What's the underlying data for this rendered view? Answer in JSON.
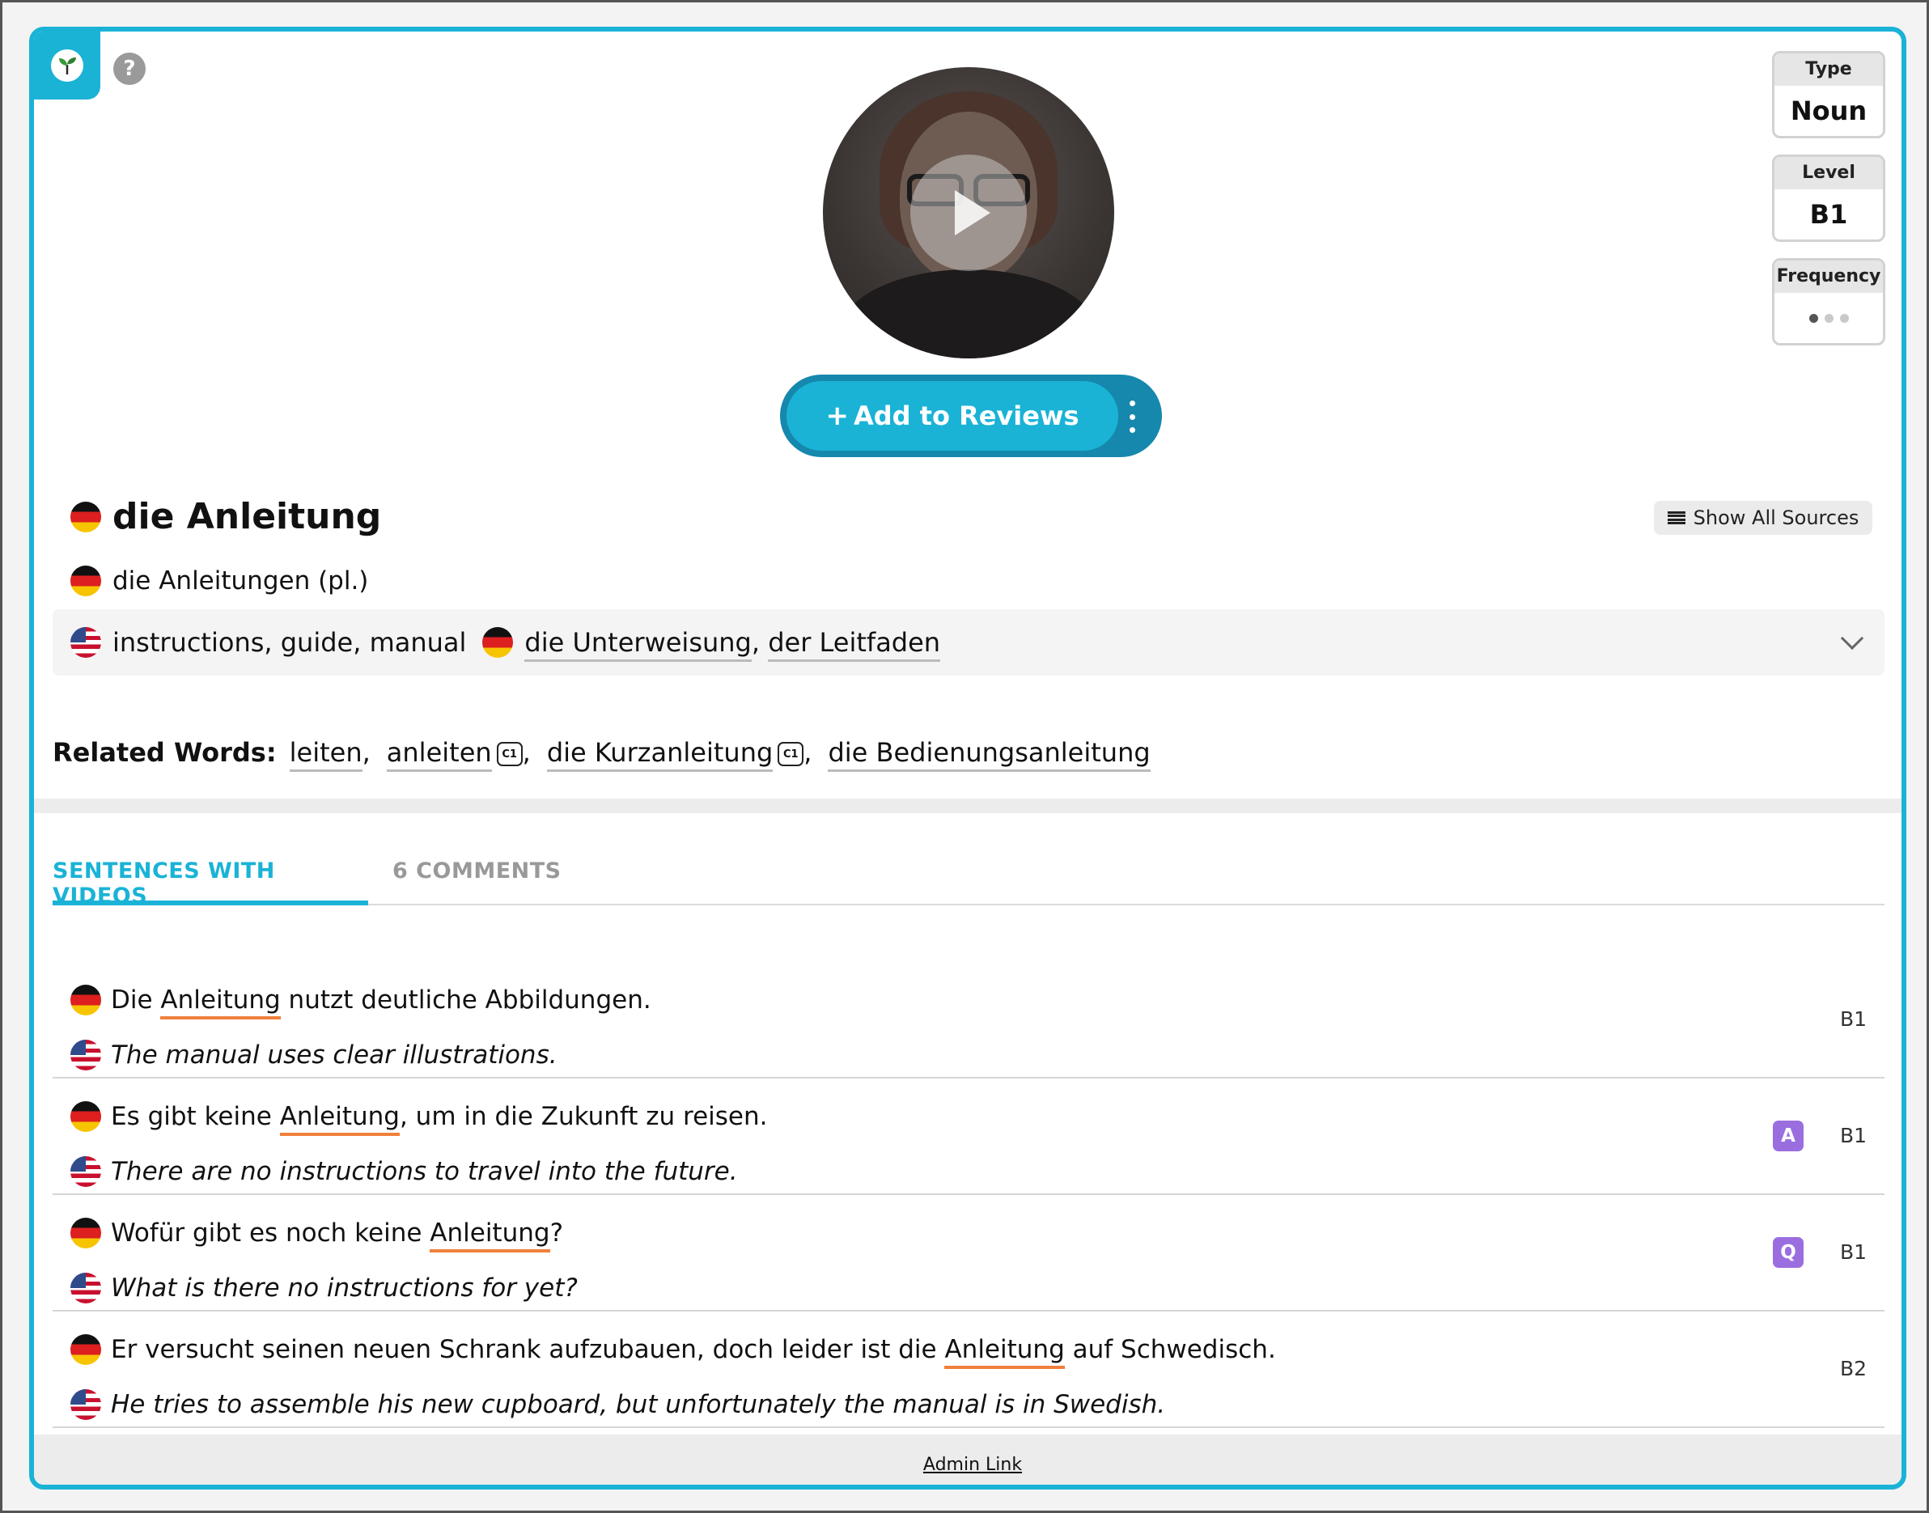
{
  "meta": {
    "type_label": "Type",
    "type_value": "Noun",
    "level_label": "Level",
    "level_value": "B1",
    "frequency_label": "Frequency",
    "frequency_level": 1,
    "frequency_max": 3
  },
  "colors": {
    "accent": "#1ab3d6",
    "highlight": "#f0803c",
    "badge": "#9b6ee0"
  },
  "actions": {
    "help_label": "?",
    "add_to_reviews": "Add to Reviews",
    "show_all_sources": "Show All Sources"
  },
  "word": {
    "headword": "die Anleitung",
    "plural": "die Anleitungen (pl.)",
    "translation": "instructions, guide, manual",
    "synonyms": [
      "die Unterweisung",
      "der Leitfaden"
    ]
  },
  "related": {
    "label": "Related Words:",
    "items": [
      {
        "word": "leiten",
        "badge": ""
      },
      {
        "word": "anleiten",
        "badge": "C1"
      },
      {
        "word": "die Kurzanleitung",
        "badge": "C1"
      },
      {
        "word": "die Bedienungsanleitung",
        "badge": ""
      }
    ]
  },
  "tabs": [
    {
      "label": "SENTENCES WITH VIDEOS",
      "active": true
    },
    {
      "label": "6 COMMENTS",
      "active": false
    }
  ],
  "sentences": [
    {
      "de_before": "Die ",
      "de_hl": "Anleitung",
      "de_after": " nutzt deutliche Abbildungen.",
      "en": "The manual uses clear illustrations.",
      "level": "B1",
      "badge": ""
    },
    {
      "de_before": "Es gibt keine ",
      "de_hl": "Anleitung",
      "de_after": ", um in die Zukunft zu reisen.",
      "en": "There are no instructions to travel into the future.",
      "level": "B1",
      "badge": "A"
    },
    {
      "de_before": "Wofür gibt es noch keine ",
      "de_hl": "Anleitung",
      "de_after": "?",
      "en": "What is there no instructions for yet?",
      "level": "B1",
      "badge": "Q"
    },
    {
      "de_before": "Er versucht seinen neuen Schrank aufzubauen, doch leider ist die ",
      "de_hl": "Anleitung",
      "de_after": " auf Schwedisch.",
      "en": "He tries to assemble his new cupboard, but unfortunately the manual is in Swedish.",
      "level": "B2",
      "badge": ""
    }
  ],
  "footer": {
    "admin_link": "Admin Link"
  },
  "icons": [
    "sprout-icon",
    "help-icon",
    "play-icon",
    "kebab-icon",
    "list-icon",
    "chevron-down-icon",
    "german-flag-icon",
    "us-flag-icon"
  ]
}
